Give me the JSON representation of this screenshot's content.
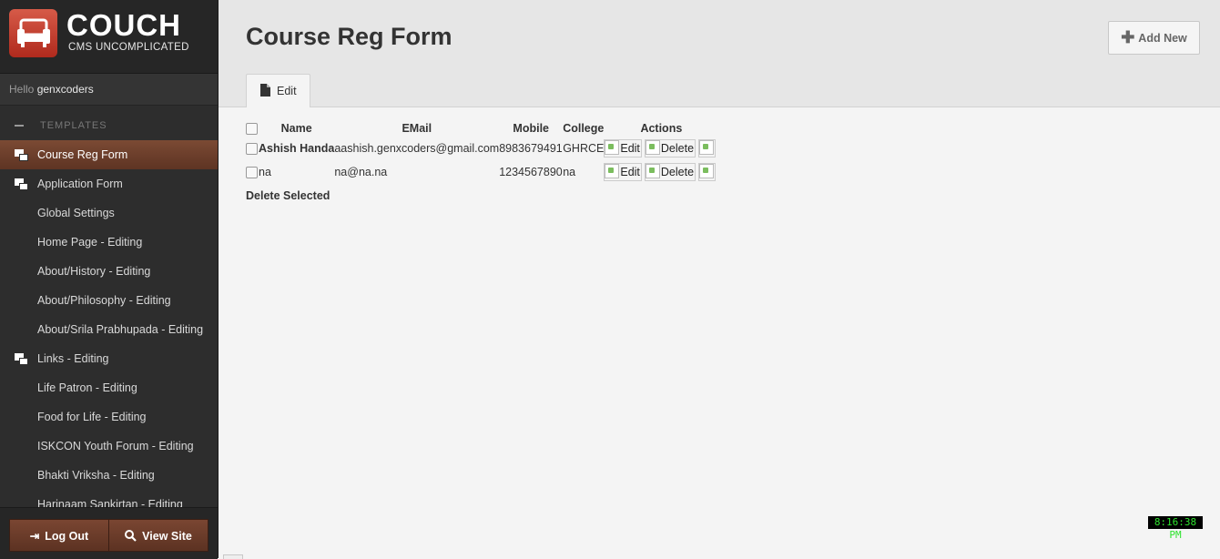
{
  "brand": {
    "title": "COUCH",
    "subtitle": "CMS UNCOMPLICATED"
  },
  "user": {
    "greeting": "Hello",
    "name": "genxcoders"
  },
  "sidebar": {
    "section_label": "TEMPLATES",
    "items": [
      {
        "label": "Course Reg Form",
        "icon": "folder-icon",
        "active": true
      },
      {
        "label": "Application Form",
        "icon": "folder-icon"
      },
      {
        "label": "Global Settings"
      },
      {
        "label": "Home Page - Editing"
      },
      {
        "label": "About/History - Editing"
      },
      {
        "label": "About/Philosophy - Editing"
      },
      {
        "label": "About/Srila Prabhupada - Editing"
      },
      {
        "label": "Links - Editing",
        "icon": "folder-icon"
      },
      {
        "label": "Life Patron - Editing"
      },
      {
        "label": "Food for Life - Editing"
      },
      {
        "label": "ISKCON Youth Forum - Editing"
      },
      {
        "label": "Bhakti Vriksha - Editing"
      },
      {
        "label": "Harinaam Sankirtan - Editing"
      }
    ]
  },
  "footer": {
    "logout_label": "Log Out",
    "viewsite_label": "View Site"
  },
  "header": {
    "title": "Course Reg Form",
    "add_new_label": "Add New",
    "tab_label": "Edit"
  },
  "table": {
    "columns": {
      "name": "Name",
      "email": "EMail",
      "mobile": "Mobile",
      "college": "College",
      "actions": "Actions"
    },
    "rows": [
      {
        "name": "Ashish Handa",
        "email": "aashish.genxcoders@gmail.com",
        "mobile": "8983679491",
        "college": "GHRCE"
      },
      {
        "name": "na",
        "email": "na@na.na",
        "mobile": "1234567890",
        "college": "na"
      }
    ],
    "edit_label": "Edit",
    "delete_label": "Delete"
  },
  "delete_selected_label": "Delete Selected",
  "clock": "8:16:38 PM",
  "colors": {
    "sidebar_bg": "#2d2d2d",
    "active_item": "#6b3d2a",
    "logo_red": "#c23a2a",
    "clock_text": "#2ee32e"
  }
}
